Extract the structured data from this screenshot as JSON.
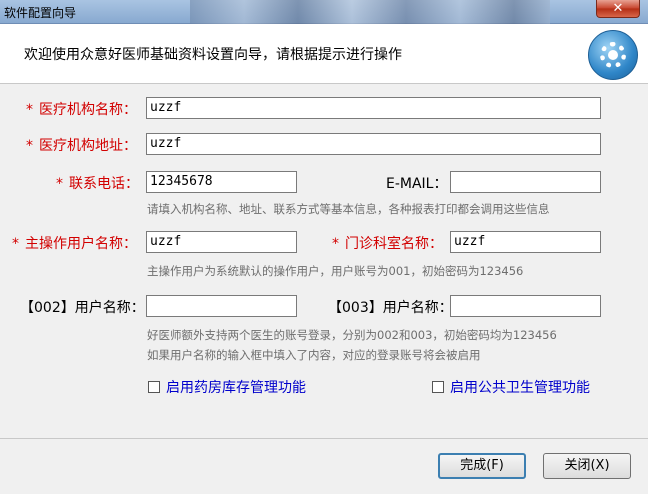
{
  "window": {
    "title": "软件配置向导",
    "close_label": "✕"
  },
  "header": {
    "welcome": "欢迎使用众意好医师基础资料设置向导，请根据提示进行操作",
    "icon": "gear-icon"
  },
  "form": {
    "org_name": {
      "label": "医疗机构名称：",
      "value": "uzzf"
    },
    "org_address": {
      "label": "医疗机构地址：",
      "value": "uzzf"
    },
    "phone": {
      "label": "联系电话：",
      "value": "12345678"
    },
    "email": {
      "label": "E-MAIL：",
      "value": ""
    },
    "hint1": "请填入机构名称、地址、联系方式等基本信息，各种报表打印都会调用这些信息",
    "operator": {
      "label": "主操作用户名称：",
      "value": "uzzf"
    },
    "clinic": {
      "label": "门诊科室名称：",
      "value": "uzzf"
    },
    "hint2": "主操作用户为系统默认的操作用户，用户账号为001，初始密码为123456",
    "user002": {
      "label": "【002】用户名称：",
      "value": ""
    },
    "user003": {
      "label": "【003】用户名称：",
      "value": ""
    },
    "hint3": "好医师额外支持两个医生的账号登录，分别为002和003，初始密码均为123456",
    "hint4": "如果用户名称的输入框中填入了内容，对应的登录账号将会被启用",
    "pharmacy_check": "启用药房库存管理功能",
    "public_health_check": "启用公共卫生管理功能"
  },
  "footer": {
    "finish_label": "完成(F)",
    "close_label": "关闭(X)"
  },
  "colors": {
    "required": "#d20000",
    "link": "#0000cc",
    "hint": "#6e6e6e"
  }
}
